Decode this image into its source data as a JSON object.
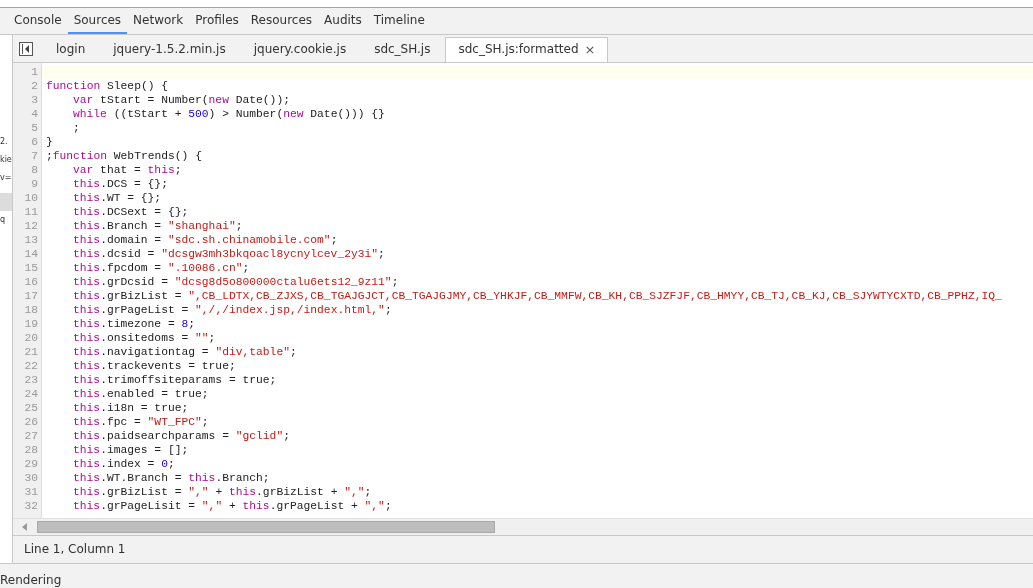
{
  "panel_tabs": [
    {
      "label": "Console",
      "selected": false
    },
    {
      "label": "Sources",
      "selected": true
    },
    {
      "label": "Network",
      "selected": false
    },
    {
      "label": "Profiles",
      "selected": false
    },
    {
      "label": "Resources",
      "selected": false
    },
    {
      "label": "Audits",
      "selected": false
    },
    {
      "label": "Timeline",
      "selected": false
    }
  ],
  "navigator_fragments": [
    {
      "text": "2.",
      "selected": false
    },
    {
      "text": "kie",
      "selected": false
    },
    {
      "text": "v=",
      "selected": false
    },
    {
      "selected": true
    },
    {
      "text": "q",
      "selected": false
    }
  ],
  "file_tabs": [
    {
      "label": "login",
      "selected": false
    },
    {
      "label": "jquery-1.5.2.min.js",
      "selected": false
    },
    {
      "label": "jquery.cookie.js",
      "selected": false
    },
    {
      "label": "sdc_SH.js",
      "selected": false
    },
    {
      "label": "sdc_SH.js:formatted",
      "selected": true,
      "close": "×"
    }
  ],
  "code_lines": [
    {
      "number": "1",
      "current": true,
      "indent": false
    },
    {
      "number": "2",
      "current": false,
      "indent": false,
      "tokens": [
        {
          "kind": "keyword",
          "text": "function"
        },
        {
          "kind": "plain",
          "text": " Sleep() {"
        }
      ]
    },
    {
      "number": "3",
      "current": false,
      "indent": true,
      "tokens": [
        {
          "kind": "keyword",
          "text": "var"
        },
        {
          "kind": "plain",
          "text": " tStart = Number("
        },
        {
          "kind": "keyword",
          "text": "new"
        },
        {
          "kind": "plain",
          "text": " Date());"
        }
      ]
    },
    {
      "number": "4",
      "current": false,
      "indent": true,
      "tokens": [
        {
          "kind": "keyword",
          "text": "while"
        },
        {
          "kind": "plain",
          "text": " ((tStart + "
        },
        {
          "kind": "number",
          "text": "500"
        },
        {
          "kind": "plain",
          "text": ") > Number("
        },
        {
          "kind": "keyword",
          "text": "new"
        },
        {
          "kind": "plain",
          "text": " Date())) {}"
        }
      ]
    },
    {
      "number": "5",
      "current": false,
      "indent": true,
      "tokens": [
        {
          "kind": "plain",
          "text": ";"
        }
      ]
    },
    {
      "number": "6",
      "current": false,
      "indent": false,
      "tokens": [
        {
          "kind": "plain",
          "text": "}"
        }
      ]
    },
    {
      "number": "7",
      "current": false,
      "indent": false,
      "tokens": [
        {
          "kind": "plain",
          "text": ";"
        },
        {
          "kind": "keyword",
          "text": "function"
        },
        {
          "kind": "plain",
          "text": " WebTrends() {"
        }
      ]
    },
    {
      "number": "8",
      "current": false,
      "indent": true,
      "tokens": [
        {
          "kind": "keyword",
          "text": "var"
        },
        {
          "kind": "plain",
          "text": " that = "
        },
        {
          "kind": "keyword",
          "text": "this"
        },
        {
          "kind": "plain",
          "text": ";"
        }
      ]
    },
    {
      "number": "9",
      "current": false,
      "indent": true,
      "tokens": [
        {
          "kind": "keyword",
          "text": "this"
        },
        {
          "kind": "plain",
          "text": ".DCS = {};"
        }
      ]
    },
    {
      "number": "10",
      "current": false,
      "indent": true,
      "tokens": [
        {
          "kind": "keyword",
          "text": "this"
        },
        {
          "kind": "plain",
          "text": ".WT = {};"
        }
      ]
    },
    {
      "number": "11",
      "current": false,
      "indent": true,
      "tokens": [
        {
          "kind": "keyword",
          "text": "this"
        },
        {
          "kind": "plain",
          "text": ".DCSext = {};"
        }
      ]
    },
    {
      "number": "12",
      "current": false,
      "indent": true,
      "tokens": [
        {
          "kind": "keyword",
          "text": "this"
        },
        {
          "kind": "plain",
          "text": ".Branch = "
        },
        {
          "kind": "string",
          "text": "\"shanghai\""
        },
        {
          "kind": "plain",
          "text": ";"
        }
      ]
    },
    {
      "number": "13",
      "current": false,
      "indent": true,
      "tokens": [
        {
          "kind": "keyword",
          "text": "this"
        },
        {
          "kind": "plain",
          "text": ".domain = "
        },
        {
          "kind": "string",
          "text": "\"sdc.sh.chinamobile.com\""
        },
        {
          "kind": "plain",
          "text": ";"
        }
      ]
    },
    {
      "number": "14",
      "current": false,
      "indent": true,
      "tokens": [
        {
          "kind": "keyword",
          "text": "this"
        },
        {
          "kind": "plain",
          "text": ".dcsid = "
        },
        {
          "kind": "string",
          "text": "\"dcsgw3mh3bkqoacl8ycnylcev_2y3i\""
        },
        {
          "kind": "plain",
          "text": ";"
        }
      ]
    },
    {
      "number": "15",
      "current": false,
      "indent": true,
      "tokens": [
        {
          "kind": "keyword",
          "text": "this"
        },
        {
          "kind": "plain",
          "text": ".fpcdom = "
        },
        {
          "kind": "string",
          "text": "\".10086.cn\""
        },
        {
          "kind": "plain",
          "text": ";"
        }
      ]
    },
    {
      "number": "16",
      "current": false,
      "indent": true,
      "tokens": [
        {
          "kind": "keyword",
          "text": "this"
        },
        {
          "kind": "plain",
          "text": ".grDcsid = "
        },
        {
          "kind": "string",
          "text": "\"dcsg8d5o800000ctalu6ets12_9z11\""
        },
        {
          "kind": "plain",
          "text": ";"
        }
      ]
    },
    {
      "number": "17",
      "current": false,
      "indent": true,
      "tokens": [
        {
          "kind": "keyword",
          "text": "this"
        },
        {
          "kind": "plain",
          "text": ".grBizList = "
        },
        {
          "kind": "string",
          "text": "\",CB_LDTX,CB_ZJXS,CB_TGAJGJCT,CB_TGAJGJMY,CB_YHKJF,CB_MMFW,CB_KH,CB_SJZFJF,CB_HMYY,CB_TJ,CB_KJ,CB_SJYWTYCXTD,CB_PPHZ,IQ_"
        }
      ]
    },
    {
      "number": "18",
      "current": false,
      "indent": true,
      "tokens": [
        {
          "kind": "keyword",
          "text": "this"
        },
        {
          "kind": "plain",
          "text": ".grPageList = "
        },
        {
          "kind": "string",
          "text": "\",/,/index.jsp,/index.html,\""
        },
        {
          "kind": "plain",
          "text": ";"
        }
      ]
    },
    {
      "number": "19",
      "current": false,
      "indent": true,
      "tokens": [
        {
          "kind": "keyword",
          "text": "this"
        },
        {
          "kind": "plain",
          "text": ".timezone = "
        },
        {
          "kind": "number",
          "text": "8"
        },
        {
          "kind": "plain",
          "text": ";"
        }
      ]
    },
    {
      "number": "20",
      "current": false,
      "indent": true,
      "tokens": [
        {
          "kind": "keyword",
          "text": "this"
        },
        {
          "kind": "plain",
          "text": ".onsitedoms = "
        },
        {
          "kind": "string",
          "text": "\"\""
        },
        {
          "kind": "plain",
          "text": ";"
        }
      ]
    },
    {
      "number": "21",
      "current": false,
      "indent": true,
      "tokens": [
        {
          "kind": "keyword",
          "text": "this"
        },
        {
          "kind": "plain",
          "text": ".navigationtag = "
        },
        {
          "kind": "string",
          "text": "\"div,table\""
        },
        {
          "kind": "plain",
          "text": ";"
        }
      ]
    },
    {
      "number": "22",
      "current": false,
      "indent": true,
      "tokens": [
        {
          "kind": "keyword",
          "text": "this"
        },
        {
          "kind": "plain",
          "text": ".trackevents = true;"
        }
      ]
    },
    {
      "number": "23",
      "current": false,
      "indent": true,
      "tokens": [
        {
          "kind": "keyword",
          "text": "this"
        },
        {
          "kind": "plain",
          "text": ".trimoffsiteparams = true;"
        }
      ]
    },
    {
      "number": "24",
      "current": false,
      "indent": true,
      "tokens": [
        {
          "kind": "keyword",
          "text": "this"
        },
        {
          "kind": "plain",
          "text": ".enabled = true;"
        }
      ]
    },
    {
      "number": "25",
      "current": false,
      "indent": true,
      "tokens": [
        {
          "kind": "keyword",
          "text": "this"
        },
        {
          "kind": "plain",
          "text": ".i18n = true;"
        }
      ]
    },
    {
      "number": "26",
      "current": false,
      "indent": true,
      "tokens": [
        {
          "kind": "keyword",
          "text": "this"
        },
        {
          "kind": "plain",
          "text": ".fpc = "
        },
        {
          "kind": "string",
          "text": "\"WT_FPC\""
        },
        {
          "kind": "plain",
          "text": ";"
        }
      ]
    },
    {
      "number": "27",
      "current": false,
      "indent": true,
      "tokens": [
        {
          "kind": "keyword",
          "text": "this"
        },
        {
          "kind": "plain",
          "text": ".paidsearchparams = "
        },
        {
          "kind": "string",
          "text": "\"gclid\""
        },
        {
          "kind": "plain",
          "text": ";"
        }
      ]
    },
    {
      "number": "28",
      "current": false,
      "indent": true,
      "tokens": [
        {
          "kind": "keyword",
          "text": "this"
        },
        {
          "kind": "plain",
          "text": ".images = [];"
        }
      ]
    },
    {
      "number": "29",
      "current": false,
      "indent": true,
      "tokens": [
        {
          "kind": "keyword",
          "text": "this"
        },
        {
          "kind": "plain",
          "text": ".index = "
        },
        {
          "kind": "number",
          "text": "0"
        },
        {
          "kind": "plain",
          "text": ";"
        }
      ]
    },
    {
      "number": "30",
      "current": false,
      "indent": true,
      "tokens": [
        {
          "kind": "keyword",
          "text": "this"
        },
        {
          "kind": "plain",
          "text": ".WT.Branch = "
        },
        {
          "kind": "keyword",
          "text": "this"
        },
        {
          "kind": "plain",
          "text": ".Branch;"
        }
      ]
    },
    {
      "number": "31",
      "current": false,
      "indent": true,
      "tokens": [
        {
          "kind": "keyword",
          "text": "this"
        },
        {
          "kind": "plain",
          "text": ".grBizList = "
        },
        {
          "kind": "string",
          "text": "\",\""
        },
        {
          "kind": "plain",
          "text": " + "
        },
        {
          "kind": "keyword",
          "text": "this"
        },
        {
          "kind": "plain",
          "text": ".grBizList + "
        },
        {
          "kind": "string",
          "text": "\",\""
        },
        {
          "kind": "plain",
          "text": ";"
        }
      ]
    },
    {
      "number": "32",
      "current": false,
      "indent": true,
      "tokens": [
        {
          "kind": "keyword",
          "text": "this"
        },
        {
          "kind": "plain",
          "text": ".grPageLisit = "
        },
        {
          "kind": "string",
          "text": "\",\""
        },
        {
          "kind": "plain",
          "text": " + "
        },
        {
          "kind": "keyword",
          "text": "this"
        },
        {
          "kind": "plain",
          "text": ".grPageList + "
        },
        {
          "kind": "string",
          "text": "\",\""
        },
        {
          "kind": "plain",
          "text": ";"
        }
      ]
    }
  ],
  "status_bar": {
    "position": "Line 1, Column 1"
  },
  "drawer": {
    "title": "Rendering"
  }
}
